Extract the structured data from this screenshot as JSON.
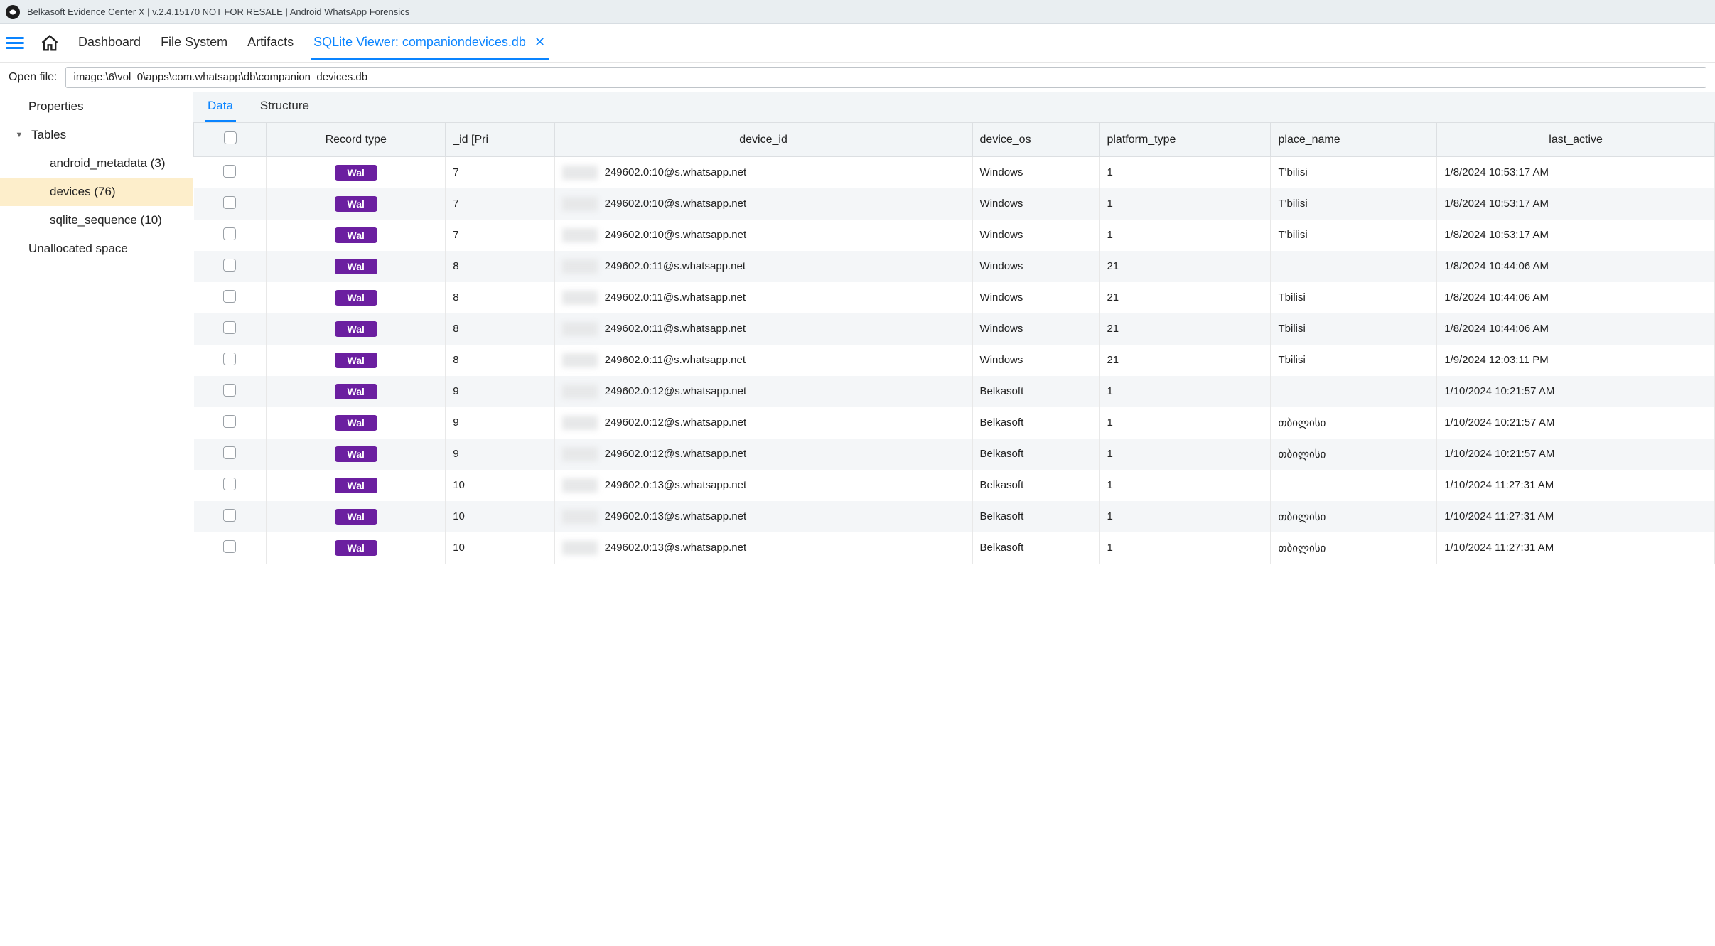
{
  "titlebar": {
    "text": "Belkasoft Evidence Center X | v.2.4.15170 NOT FOR RESALE | Android WhatsApp Forensics"
  },
  "nav": {
    "items": [
      {
        "label": "Dashboard",
        "active": false
      },
      {
        "label": "File System",
        "active": false
      },
      {
        "label": "Artifacts",
        "active": false
      },
      {
        "label": "SQLite Viewer: companiondevices.db",
        "active": true,
        "closable": true
      }
    ]
  },
  "openfile": {
    "label": "Open file:",
    "value": "image:\\6\\vol_0\\apps\\com.whatsapp\\db\\companion_devices.db"
  },
  "sidebar": {
    "items": [
      {
        "label": "Properties",
        "level": 0,
        "expanded": false,
        "expandable": false
      },
      {
        "label": "Tables",
        "level": 0,
        "expanded": true,
        "expandable": true
      },
      {
        "label": "android_metadata  (3)",
        "level": 1
      },
      {
        "label": "devices  (76)",
        "level": 1,
        "selected": true
      },
      {
        "label": "sqlite_sequence  (10)",
        "level": 1
      },
      {
        "label": "Unallocated space",
        "level": 0,
        "expandable": false
      }
    ]
  },
  "subtabs": [
    {
      "label": "Data",
      "active": true
    },
    {
      "label": "Structure",
      "active": false
    }
  ],
  "table": {
    "columns": [
      "",
      "Record type",
      "_id [Pri",
      "device_id",
      "device_os",
      "platform_type",
      "place_name",
      "last_active"
    ],
    "record_type_badge": "Wal",
    "rows": [
      {
        "id": "7",
        "device_id": "249602.0:10@s.whatsapp.net",
        "device_os": "Windows",
        "platform_type": "1",
        "place_name": "T'bilisi",
        "last_active": "1/8/2024 10:53:17 AM"
      },
      {
        "id": "7",
        "device_id": "249602.0:10@s.whatsapp.net",
        "device_os": "Windows",
        "platform_type": "1",
        "place_name": "T'bilisi",
        "last_active": "1/8/2024 10:53:17 AM"
      },
      {
        "id": "7",
        "device_id": "249602.0:10@s.whatsapp.net",
        "device_os": "Windows",
        "platform_type": "1",
        "place_name": "T'bilisi",
        "last_active": "1/8/2024 10:53:17 AM"
      },
      {
        "id": "8",
        "device_id": "249602.0:11@s.whatsapp.net",
        "device_os": "Windows",
        "platform_type": "21",
        "place_name": "",
        "last_active": "1/8/2024 10:44:06 AM"
      },
      {
        "id": "8",
        "device_id": "249602.0:11@s.whatsapp.net",
        "device_os": "Windows",
        "platform_type": "21",
        "place_name": "Tbilisi",
        "last_active": "1/8/2024 10:44:06 AM"
      },
      {
        "id": "8",
        "device_id": "249602.0:11@s.whatsapp.net",
        "device_os": "Windows",
        "platform_type": "21",
        "place_name": "Tbilisi",
        "last_active": "1/8/2024 10:44:06 AM"
      },
      {
        "id": "8",
        "device_id": "249602.0:11@s.whatsapp.net",
        "device_os": "Windows",
        "platform_type": "21",
        "place_name": "Tbilisi",
        "last_active": "1/9/2024 12:03:11 PM"
      },
      {
        "id": "9",
        "device_id": "249602.0:12@s.whatsapp.net",
        "device_os": "Belkasoft",
        "platform_type": "1",
        "place_name": "",
        "last_active": "1/10/2024 10:21:57 AM"
      },
      {
        "id": "9",
        "device_id": "249602.0:12@s.whatsapp.net",
        "device_os": "Belkasoft",
        "platform_type": "1",
        "place_name": "თბილისი",
        "last_active": "1/10/2024 10:21:57 AM"
      },
      {
        "id": "9",
        "device_id": "249602.0:12@s.whatsapp.net",
        "device_os": "Belkasoft",
        "platform_type": "1",
        "place_name": "თბილისი",
        "last_active": "1/10/2024 10:21:57 AM"
      },
      {
        "id": "10",
        "device_id": "249602.0:13@s.whatsapp.net",
        "device_os": "Belkasoft",
        "platform_type": "1",
        "place_name": "",
        "last_active": "1/10/2024 11:27:31 AM"
      },
      {
        "id": "10",
        "device_id": "249602.0:13@s.whatsapp.net",
        "device_os": "Belkasoft",
        "platform_type": "1",
        "place_name": "თბილისი",
        "last_active": "1/10/2024 11:27:31 AM"
      },
      {
        "id": "10",
        "device_id": "249602.0:13@s.whatsapp.net",
        "device_os": "Belkasoft",
        "platform_type": "1",
        "place_name": "თბილისი",
        "last_active": "1/10/2024 11:27:31 AM"
      }
    ]
  }
}
